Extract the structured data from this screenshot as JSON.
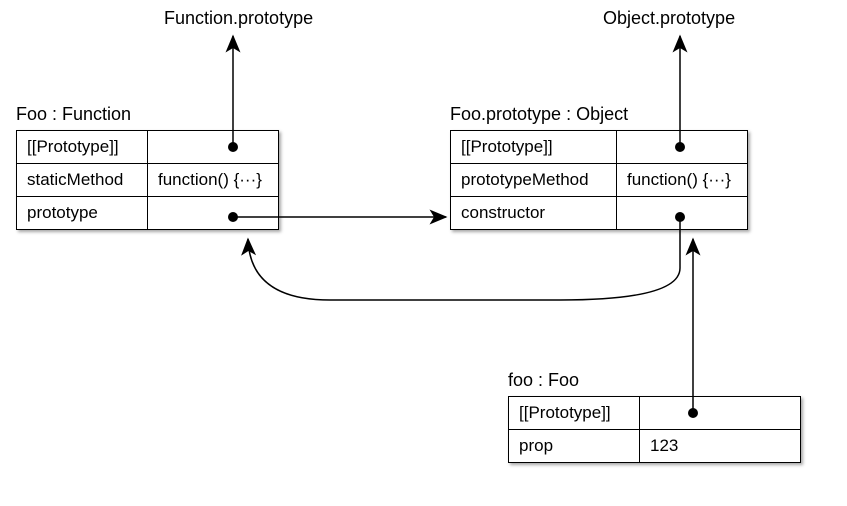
{
  "topLabels": {
    "functionPrototype": "Function.prototype",
    "objectPrototype": "Object.prototype"
  },
  "fooFunction": {
    "title": "Foo : Function",
    "rows": {
      "protoSlot": "[[Prototype]]",
      "staticMethodKey": "staticMethod",
      "staticMethodVal": "function() {···}",
      "prototypeKey": "prototype"
    }
  },
  "fooPrototype": {
    "title": "Foo.prototype : Object",
    "rows": {
      "protoSlot": "[[Prototype]]",
      "prototypeMethodKey": "prototypeMethod",
      "prototypeMethodVal": "function() {···}",
      "constructorKey": "constructor"
    }
  },
  "fooInstance": {
    "title": "foo : Foo",
    "rows": {
      "protoSlot": "[[Prototype]]",
      "propKey": "prop",
      "propVal": "123"
    }
  }
}
